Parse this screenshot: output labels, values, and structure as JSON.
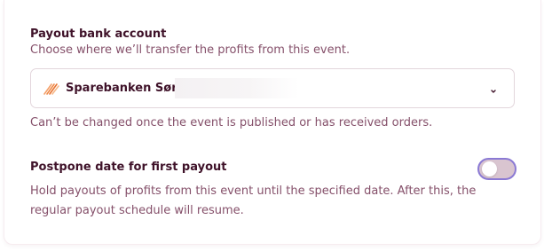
{
  "payout_account": {
    "title": "Payout bank account",
    "description": "Choose where we’ll transfer the profits from this event.",
    "selected_bank": "Sparebanken Sør",
    "bank_icon": "sparebanken-logo-icon",
    "note": "Can’t be changed once the event is published or has received orders."
  },
  "postpone": {
    "title": "Postpone date for first payout",
    "description": "Hold payouts of profits from this event until the specified date. After this, the regular payout schedule will resume.",
    "toggle_on": false
  },
  "colors": {
    "heading": "#3f1229",
    "body_text": "#85506a",
    "toggle_focus_ring": "#8b7ad4",
    "toggle_track": "#d9c5d0",
    "logo_orange": "#f08a3c"
  }
}
